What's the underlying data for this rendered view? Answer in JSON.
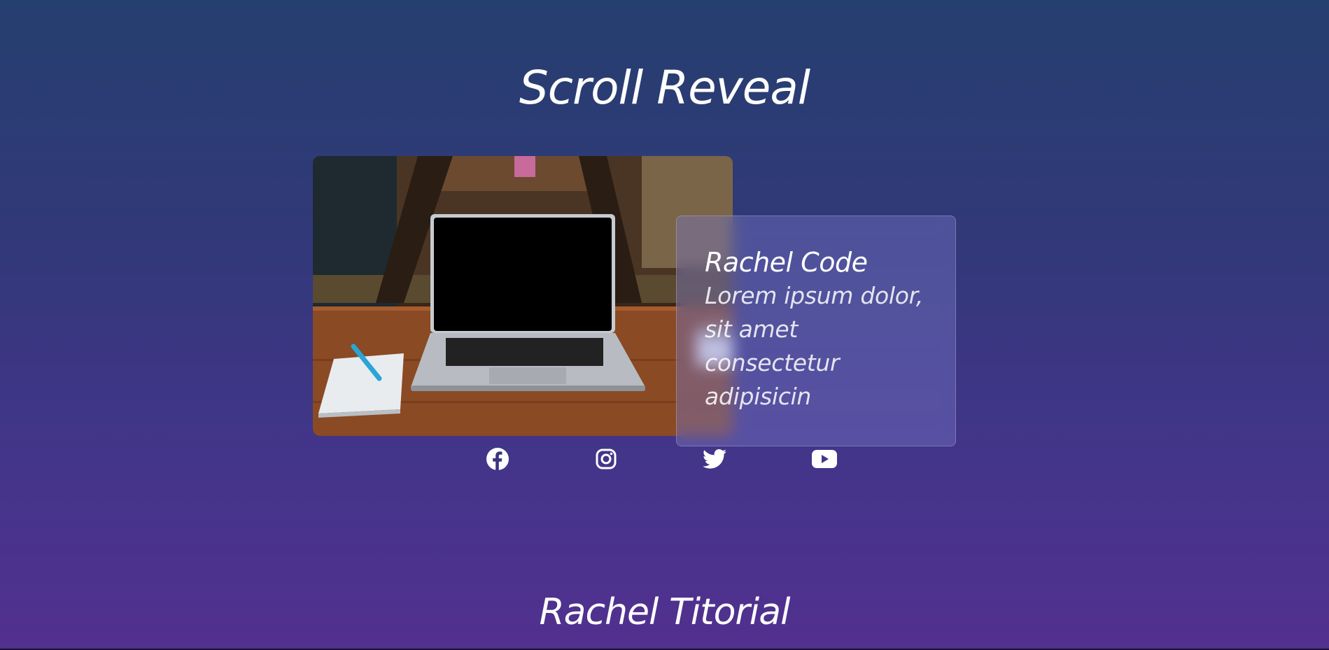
{
  "header": {
    "title": "Scroll Reveal"
  },
  "card": {
    "title": "Rachel Code",
    "text": "Lorem ipsum dolor, sit amet consectetur adipisicin"
  },
  "social": {
    "icons": [
      "facebook-icon",
      "instagram-icon",
      "twitter-icon",
      "youtube-icon"
    ]
  },
  "footer": {
    "title": "Rachel Titorial"
  },
  "colors": {
    "gradient_top": "#253f6f",
    "gradient_bottom": "#52308f",
    "text": "#ffffff"
  }
}
